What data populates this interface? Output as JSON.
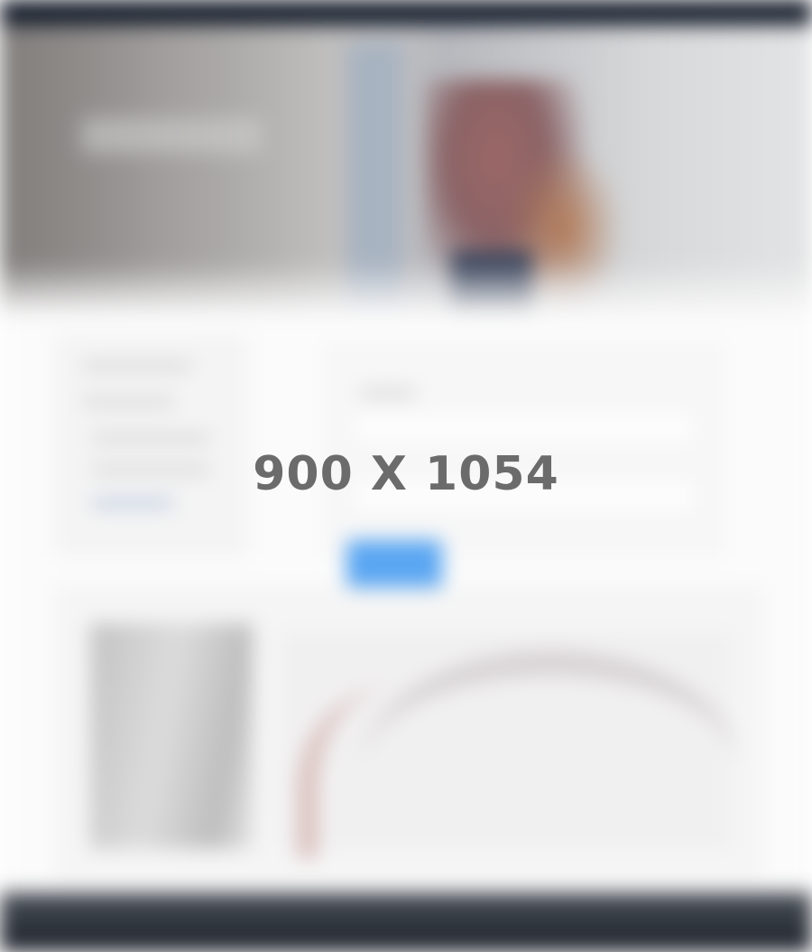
{
  "placeholder": {
    "label": "900 X 1054"
  },
  "colors": {
    "topbar": "#0c1320",
    "button": "#5aa6f2",
    "footer": "#1b2029",
    "label": "#6b6b6b"
  },
  "icons": []
}
